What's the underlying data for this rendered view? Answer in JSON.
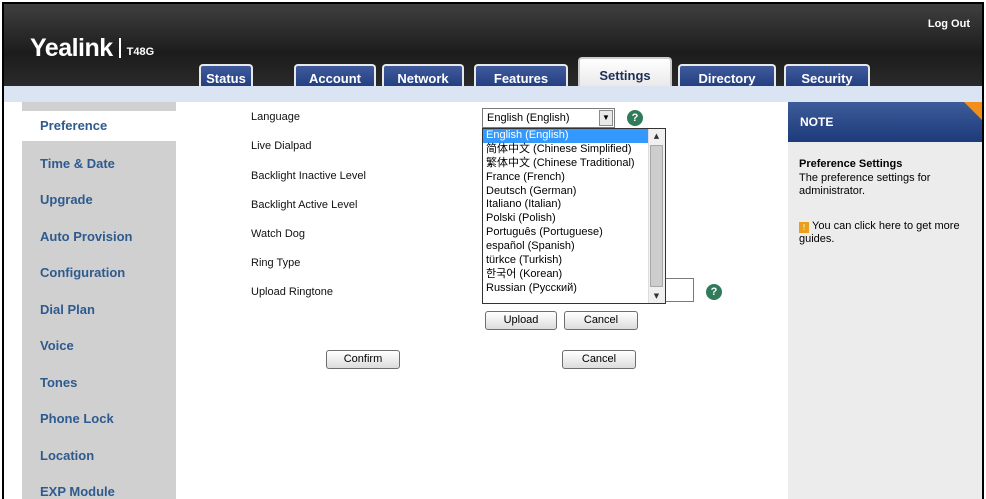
{
  "header": {
    "logo": "Yealink",
    "model": "T48G",
    "logout_label": "Log Out"
  },
  "tabs": [
    {
      "label": "Status"
    },
    {
      "label": "Account"
    },
    {
      "label": "Network"
    },
    {
      "label": "Features"
    },
    {
      "label": "Settings",
      "active": true
    },
    {
      "label": "Directory"
    },
    {
      "label": "Security"
    }
  ],
  "sidebar": {
    "items": [
      {
        "label": "Preference",
        "active": true
      },
      {
        "label": "Time & Date"
      },
      {
        "label": "Upgrade"
      },
      {
        "label": "Auto Provision"
      },
      {
        "label": "Configuration"
      },
      {
        "label": "Dial Plan"
      },
      {
        "label": "Voice"
      },
      {
        "label": "Tones"
      },
      {
        "label": "Phone Lock"
      },
      {
        "label": "Location"
      },
      {
        "label": "EXP Module"
      }
    ]
  },
  "form": {
    "language_label": "Language",
    "live_dialpad_label": "Live Dialpad",
    "backlight_inactive_label": "Backlight Inactive Level",
    "backlight_active_label": "Backlight Active Level",
    "watch_dog_label": "Watch Dog",
    "ring_type_label": "Ring Type",
    "upload_ringtone_label": "Upload Ringtone",
    "language_value": "English (English)",
    "upload_button": "Upload",
    "upload_cancel_button": "Cancel",
    "confirm_button": "Confirm",
    "cancel_button": "Cancel",
    "help_glyph": "?"
  },
  "language_options": [
    "English (English)",
    "简体中文 (Chinese Simplified)",
    "繁体中文 (Chinese Traditional)",
    "France (French)",
    "Deutsch (German)",
    "Italiano (Italian)",
    "Polski (Polish)",
    "Português (Portuguese)",
    "español (Spanish)",
    "türkce (Turkish)",
    "한국어 (Korean)",
    "Russian (Pусский)"
  ],
  "note": {
    "title": "NOTE",
    "heading": "Preference Settings",
    "body": "The preference settings for administrator.",
    "tip": "You can click here to get more guides."
  },
  "colors": {
    "tab_blue": "#1f3a7c",
    "sidebar_link": "#2e5a8e",
    "help_green": "#2f7b5a",
    "note_corner": "#f18e1c",
    "selected_option": "#3399ff"
  }
}
